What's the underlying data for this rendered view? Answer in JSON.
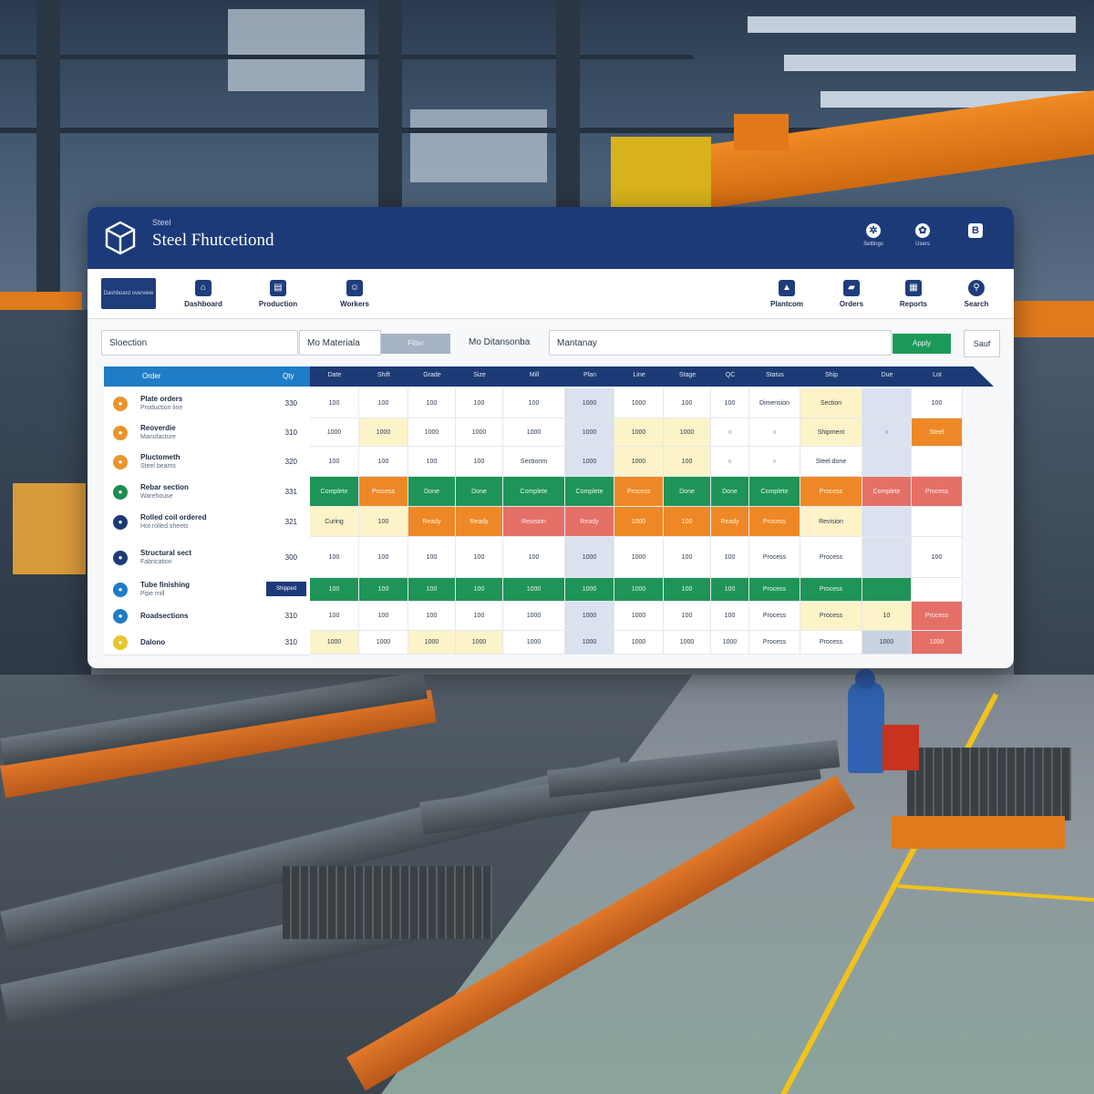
{
  "app": {
    "kicker": "Steel",
    "title": "Steel Fhutcetiond"
  },
  "titlebar_icons": [
    {
      "icon": "gear-icon",
      "label": "Settings"
    },
    {
      "icon": "users-icon",
      "label": "Users"
    },
    {
      "icon": "b-icon",
      "label": "B"
    }
  ],
  "nav": {
    "active_label": "Dashboard overview",
    "items": [
      {
        "icon": "home-icon",
        "label": "Dashboard"
      },
      {
        "icon": "clipboard-icon",
        "label": "Production"
      },
      {
        "icon": "worker-icon",
        "label": "Workers"
      },
      {
        "icon": "factory-icon",
        "label": "Plantcom"
      },
      {
        "icon": "truck-icon",
        "label": "Orders"
      },
      {
        "icon": "report-icon",
        "label": "Reports"
      },
      {
        "icon": "search-icon",
        "label": "Search"
      }
    ]
  },
  "filters": {
    "box1": "Sloection",
    "box2": "Mo Materiala",
    "btn_gray": "Filter",
    "box3": "Mo Ditansonba",
    "box4": "Mantanay",
    "btn_green": "Apply",
    "btn_small": "Sauf"
  },
  "grid": {
    "head_left": [
      "Order",
      "Qty"
    ],
    "head_right": [
      "Date",
      "Shift",
      "Grade",
      "Size",
      "Mill",
      "Plan",
      "Line",
      "Stage",
      "QC",
      "Status",
      "Ship",
      "Due",
      "Lot"
    ],
    "rows": [
      {
        "t1": "Plate orders",
        "t2": "Production line",
        "num": "330",
        "dot": "#e8952a"
      },
      {
        "t1": "Reoverdie",
        "t2": "Manufacture",
        "num": "310",
        "dot": "#e8952a"
      },
      {
        "t1": "Pluctometh",
        "t2": "Steel beams",
        "num": "320",
        "dot": "#e8952a"
      },
      {
        "t1": "Rebar section",
        "t2": "Warehouse",
        "num": "331",
        "dot": "#1f8a52"
      },
      {
        "t1": "Rolled coil ordered",
        "t2": "Hot rolled sheets",
        "num": "321",
        "dot": "#1d3a78"
      },
      {
        "t1": "Structural sect",
        "t2": "Fabrication",
        "num": "300",
        "dot": "#1d3a78"
      },
      {
        "t1": "Tube finishing",
        "t2": "Pipe mill",
        "num": "",
        "dot": "#1f7cc6"
      },
      {
        "t1": "Roadsections",
        "t2": "",
        "num": "310",
        "dot": "#1f7cc6"
      },
      {
        "t1": "Dalono",
        "t2": "",
        "num": "310",
        "dot": "#e8c52a"
      }
    ],
    "row_tag": "Shipped",
    "cells": [
      [
        "100",
        "100",
        "100",
        "100",
        "100",
        "1000",
        "1000",
        "100",
        "100",
        "Dimension",
        "Section",
        "",
        "100"
      ],
      [
        "1000",
        "1000",
        "1000",
        "1000",
        "1000",
        "1000",
        "1000",
        "1000",
        "○",
        "○",
        "Shipment",
        "○",
        "Steel"
      ],
      [
        "100",
        "100",
        "100",
        "100",
        "Sectionm",
        "1000",
        "1000",
        "100",
        "○",
        "○",
        "Steel done",
        "",
        ""
      ],
      [
        "Complete",
        "Process",
        "Done",
        "Done",
        "Complete",
        "Complete",
        "Process",
        "Done",
        "Done",
        "Complete",
        "Process",
        "Complete",
        "Process"
      ],
      [
        "Curing",
        "100",
        "Ready",
        "Ready",
        "Revision",
        "Ready",
        "1000",
        "100",
        "Ready",
        "Process",
        "Revision",
        "",
        ""
      ],
      [
        "100",
        "100",
        "100",
        "100",
        "100",
        "1000",
        "1000",
        "100",
        "100",
        "Process",
        "Process",
        "",
        "100"
      ],
      [
        "100",
        "100",
        "100",
        "100",
        "1000",
        "1000",
        "1000",
        "100",
        "100",
        "Process",
        "Process",
        "",
        ""
      ],
      [
        "100",
        "100",
        "100",
        "100",
        "1000",
        "1000",
        "1000",
        "100",
        "100",
        "Process",
        "Process",
        "10",
        "Process"
      ],
      [
        "1000",
        "1000",
        "1000",
        "1000",
        "1000",
        "1000",
        "1000",
        "1000",
        "1000",
        "Process",
        "Process",
        "1000",
        "1000"
      ]
    ]
  }
}
